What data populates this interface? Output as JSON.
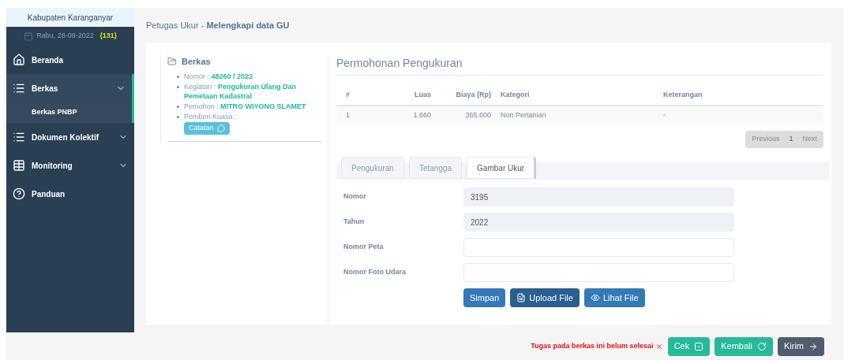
{
  "sidebar": {
    "region": "Kabupaten Karanganyar",
    "date": "Rabu, 28-09-2022",
    "count": "(131)",
    "items": [
      {
        "label": "Beranda",
        "kind": "link"
      },
      {
        "label": "Berkas",
        "kind": "group",
        "expanded": true,
        "children": [
          {
            "label": "Berkas PNBP",
            "selected": true
          }
        ]
      },
      {
        "label": "Dokumen Kolektif",
        "kind": "group",
        "expanded": false
      },
      {
        "label": "Monitoring",
        "kind": "group",
        "expanded": false
      },
      {
        "label": "Panduan",
        "kind": "link"
      }
    ]
  },
  "page_title": {
    "prefix": "Petugas Ukur - ",
    "title": "Melengkapi data GU"
  },
  "berkas": {
    "heading": "Berkas",
    "fields": [
      {
        "label": "Nomor : ",
        "value": "48260 / 2022"
      },
      {
        "label": "Kegiatan : ",
        "value": "Pengukuran Ulang Dan Pemetaan Kadastral"
      },
      {
        "label": "Pemohon : ",
        "value": "MITRO WIYONO SLAMET"
      },
      {
        "label": "Pemberi Kuasa :"
      }
    ],
    "note_button": "Catatan"
  },
  "permohonan": {
    "title": "Permohonan Pengukuran",
    "table": {
      "columns": [
        "#",
        "Luas",
        "Biaya (Rp)",
        "Kategori",
        "Keterangan"
      ],
      "rows": [
        [
          "1",
          "1.660",
          "365.600",
          "Non Pertanian",
          "-"
        ]
      ]
    },
    "pagination": {
      "previous": "Previous",
      "page": "1",
      "next": "Next"
    }
  },
  "tabs": [
    {
      "label": "Pengukuran",
      "selected": false
    },
    {
      "label": "Tetangga",
      "selected": false
    },
    {
      "label": "Gambar Ukur",
      "selected": true
    }
  ],
  "form": [
    {
      "label": "Nomor",
      "value": "3195",
      "readonly": true
    },
    {
      "label": "Tahun",
      "value": "2022",
      "readonly": true
    },
    {
      "label": "Nomor Peta",
      "readonly": false
    },
    {
      "label": "Nomor Foto Udara",
      "readonly": false
    }
  ],
  "form_buttons": [
    {
      "label": "Simpan",
      "kind": "save"
    },
    {
      "label": "Upload File",
      "kind": "upload"
    },
    {
      "label": "Lihat File",
      "kind": "view"
    }
  ],
  "footer": {
    "warning": "Tugas pada berkas ini belum selesai",
    "buttons": [
      {
        "label": "Cek",
        "kind": "check"
      },
      {
        "label": "Kembali",
        "kind": "back"
      },
      {
        "label": "Kirim",
        "kind": "send"
      }
    ]
  }
}
